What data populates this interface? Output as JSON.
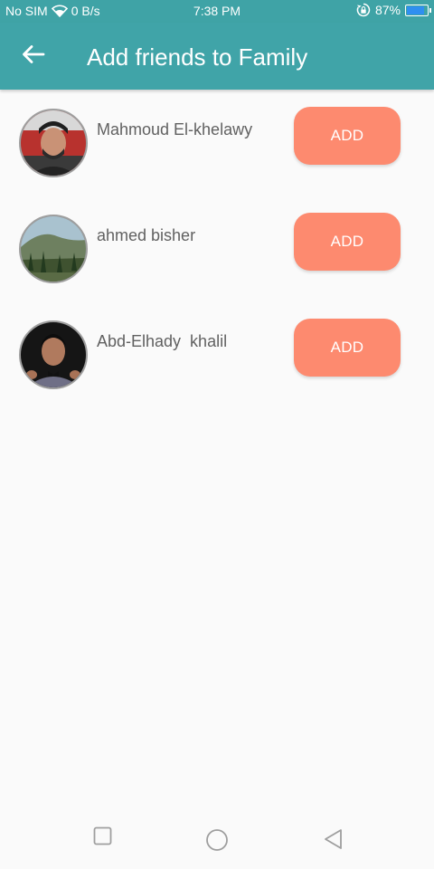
{
  "status_bar": {
    "carrier": "No SIM",
    "data_rate": "0 B/s",
    "time": "7:38 PM",
    "battery_percent": "87%",
    "battery_level": 0.87,
    "icons": [
      "wifi-icon",
      "lock-rotate-icon",
      "battery-icon"
    ]
  },
  "app_bar": {
    "title": "Add friends to Family",
    "back_icon": "arrow-left-icon"
  },
  "friends": [
    {
      "name": "Mahmoud El-khelawy",
      "button_label": "ADD",
      "avatar": "person-photo"
    },
    {
      "name": "ahmed bisher",
      "button_label": "ADD",
      "avatar": "landscape-photo"
    },
    {
      "name": "Abd-Elhady  khalil",
      "button_label": "ADD",
      "avatar": "person-photo"
    }
  ],
  "nav_bar": {
    "icons": [
      "recent-apps-icon",
      "home-icon",
      "back-icon"
    ]
  },
  "colors": {
    "app_bar": "#40a4a8",
    "status_bar": "#3fa3a6",
    "add_button": "#fd8a6f",
    "background": "#fafafa"
  }
}
